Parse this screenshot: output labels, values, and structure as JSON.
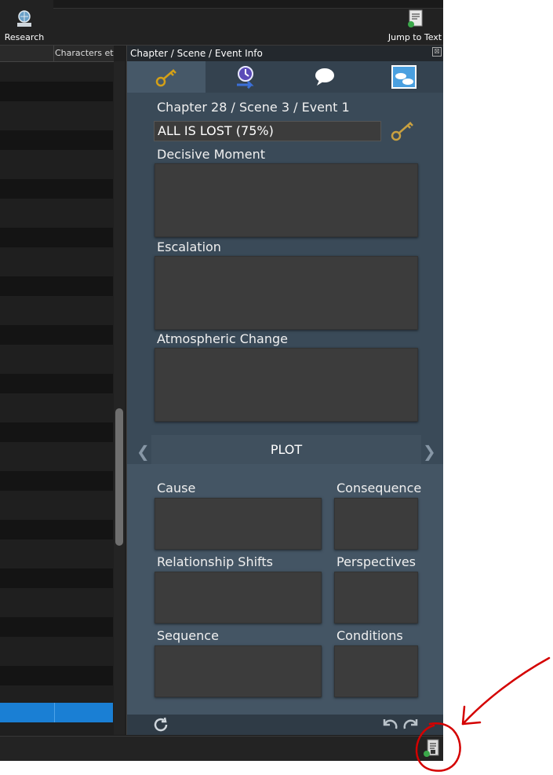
{
  "toolbar": {
    "research_label": "Research",
    "jump_label": "Jump to Text"
  },
  "list": {
    "column_characters": "Characters etc"
  },
  "info": {
    "title": "Chapter / Scene / Event Info",
    "close_glyph": "⊠",
    "heading": "Chapter 28 / Scene 3 / Event 1",
    "event_value": "ALL IS LOST (75%)",
    "decisive_moment": "Decisive Moment",
    "escalation": "Escalation",
    "atmospheric_change": "Atmospheric Change",
    "plot_label": "PLOT",
    "cause": "Cause",
    "consequence": "Consequence",
    "relationship_shifts": "Relationship Shifts",
    "perspectives": "Perspectives",
    "sequence": "Sequence",
    "conditions": "Conditions"
  },
  "icons": {
    "key": "key-icon",
    "timeline": "timeline-icon",
    "speech": "speech-bubble-icon",
    "image": "scene-image-icon"
  },
  "colors": {
    "panel_bg": "#3a4a58",
    "selected_row": "#1a7fd4",
    "annotation": "#d40000"
  }
}
